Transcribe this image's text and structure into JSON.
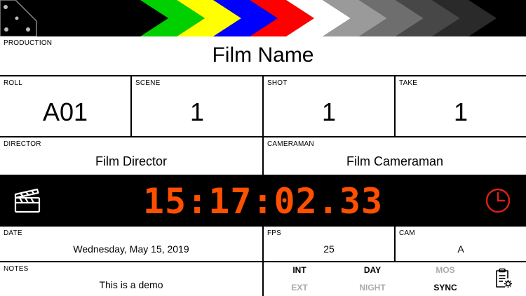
{
  "production": {
    "label": "PRODUCTION",
    "value": "Film Name"
  },
  "roll": {
    "label": "ROLL",
    "value": "A01"
  },
  "scene": {
    "label": "SCENE",
    "value": "1"
  },
  "shot": {
    "label": "SHOT",
    "value": "1"
  },
  "take": {
    "label": "TAKE",
    "value": "1"
  },
  "director": {
    "label": "DIRECTOR",
    "value": "Film Director"
  },
  "cameraman": {
    "label": "CAMERAMAN",
    "value": "Film Cameraman"
  },
  "timecode": {
    "value": "15:17:02.33",
    "color": "#ff4f00"
  },
  "date": {
    "label": "DATE",
    "value": "Wednesday, May 15, 2019"
  },
  "fps": {
    "label": "FPS",
    "value": "25"
  },
  "cam": {
    "label": "CAM",
    "value": "A"
  },
  "notes": {
    "label": "NOTES",
    "value": "This is a demo"
  },
  "flags": {
    "int": {
      "label": "INT",
      "active": true
    },
    "day": {
      "label": "DAY",
      "active": true
    },
    "mos": {
      "label": "MOS",
      "active": false
    },
    "ext": {
      "label": "EXT",
      "active": false
    },
    "night": {
      "label": "NIGHT",
      "active": false
    },
    "sync": {
      "label": "SYNC",
      "active": true
    }
  },
  "colors": {
    "active_flag": "#000000",
    "inactive_flag": "#aaaaaa",
    "clock_icon": "#e0201a",
    "stripes": [
      "#00d000",
      "#ffff00",
      "#0000ff",
      "#ff0000",
      "#ffffff",
      "#9a9a9a",
      "#6e6e6e",
      "#474747",
      "#2a2a2a"
    ]
  },
  "icons": {
    "clapper_hinge": "hinge-plate-icon",
    "slate": "clapperboard-icon",
    "clock": "clock-icon",
    "settings": "clipboard-gear-icon"
  }
}
